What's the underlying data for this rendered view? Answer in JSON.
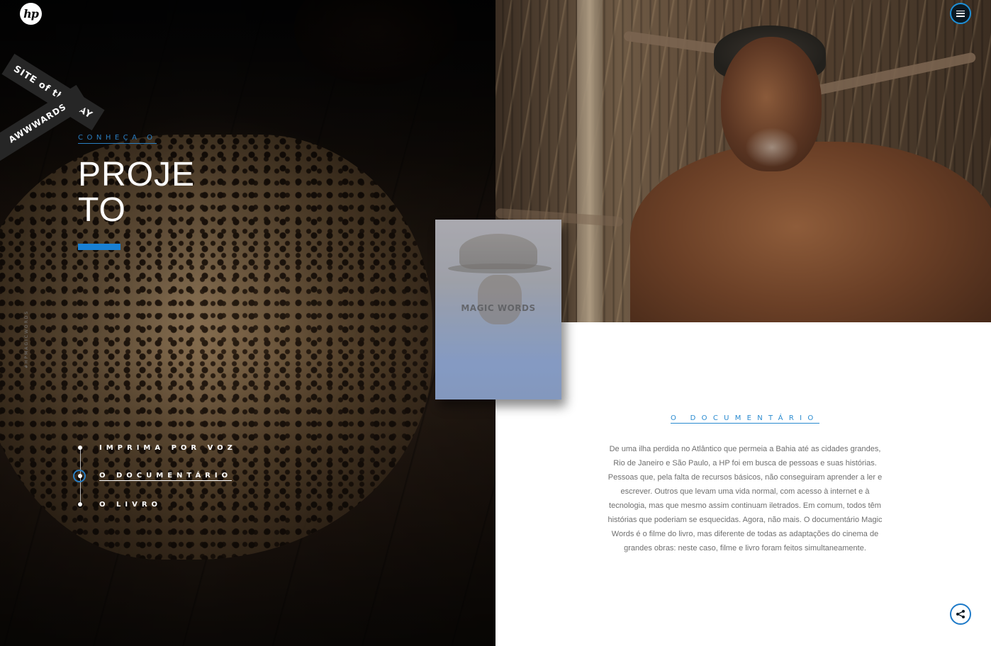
{
  "header": {
    "logo_text": "hp",
    "menu_icon": "hamburger-icon"
  },
  "award": {
    "line1": "SITE of the DAY",
    "line2": "AWWWARDS"
  },
  "hero": {
    "eyebrow": "CONHEÇA O",
    "title_line1": "PROJE",
    "title_line2": "TO"
  },
  "hashtag": "#HPMAGICWORDS",
  "nav": {
    "items": [
      {
        "label": "IMPRIMA POR VOZ",
        "active": false
      },
      {
        "label": "O DOCUMENTÁRIO",
        "active": true
      },
      {
        "label": "O LIVRO",
        "active": false
      }
    ]
  },
  "book": {
    "title": "MAGIC WORDS"
  },
  "documentary": {
    "heading": "O DOCUMENTÁRIO",
    "body": "De uma ilha perdida no Atlântico que permeia a Bahia até as cidades grandes, Rio de Janeiro e São Paulo, a HP foi em busca de pessoas e suas histórias. Pessoas que, pela falta de recursos básicos, não conseguiram aprender a ler e escrever. Outros que levam uma vida normal, com acesso à internet e à tecnologia, mas que mesmo assim continuam iletrados. Em comum, todos têm histórias que poderiam se esquecidas. Agora, não mais. O documentário Magic Words é o filme do livro, mas diferente de todas as adaptações do cinema de grandes obras: neste caso, filme e livro foram feitos simultaneamente."
  },
  "share": {
    "icon": "share-icon"
  },
  "colors": {
    "accent": "#1880d4",
    "text_gray": "#6f6f6f"
  }
}
